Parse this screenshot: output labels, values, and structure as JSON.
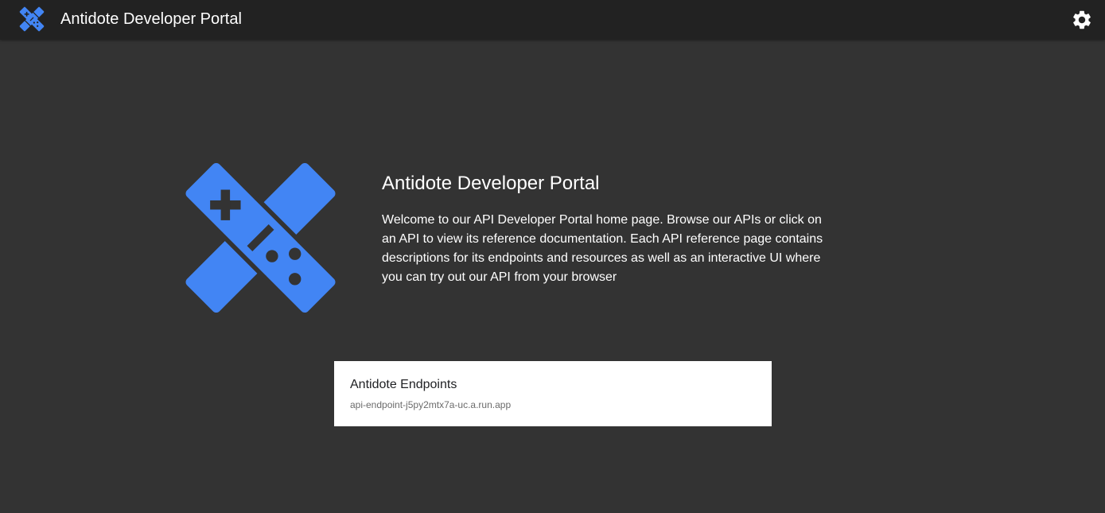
{
  "header": {
    "title": "Antidote Developer Portal",
    "logo_icon": "antidote-logo-icon",
    "settings_icon": "gear-icon"
  },
  "hero": {
    "title": "Antidote Developer Portal",
    "description": "Welcome to our API Developer Portal home page. Browse our APIs or click on an API to view its reference documentation. Each API reference page contains descriptions for its endpoints and resources as well as an interactive UI where you can try out our API from your browser",
    "logo_icon": "antidote-logo-icon"
  },
  "apis": [
    {
      "name": "Antidote Endpoints",
      "host": "api-endpoint-j5py2mtx7a-uc.a.run.app"
    }
  ],
  "colors": {
    "brand": "#4285f4",
    "background": "#333333",
    "topbar": "#222222",
    "card": "#ffffff"
  }
}
